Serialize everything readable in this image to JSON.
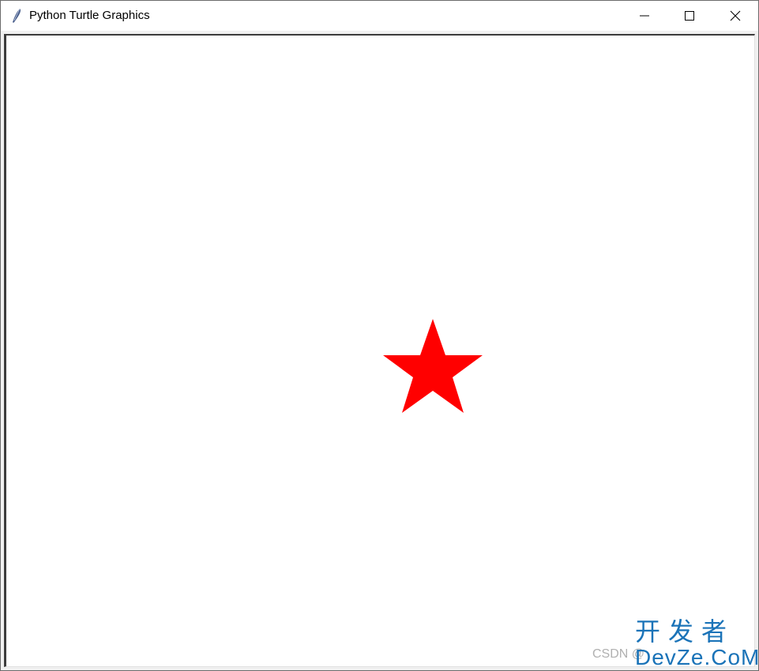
{
  "window": {
    "title": "Python Turtle Graphics",
    "icon": "feather-icon"
  },
  "controls": {
    "minimize_icon": "minimize-icon",
    "maximize_icon": "maximize-icon",
    "close_icon": "close-icon"
  },
  "canvas": {
    "background": "#ffffff",
    "shape": "star",
    "star_color": "#ff0000"
  },
  "watermark": {
    "csdn": "CSDN @",
    "cn": "开发者",
    "en": "DevZe.CoM"
  }
}
